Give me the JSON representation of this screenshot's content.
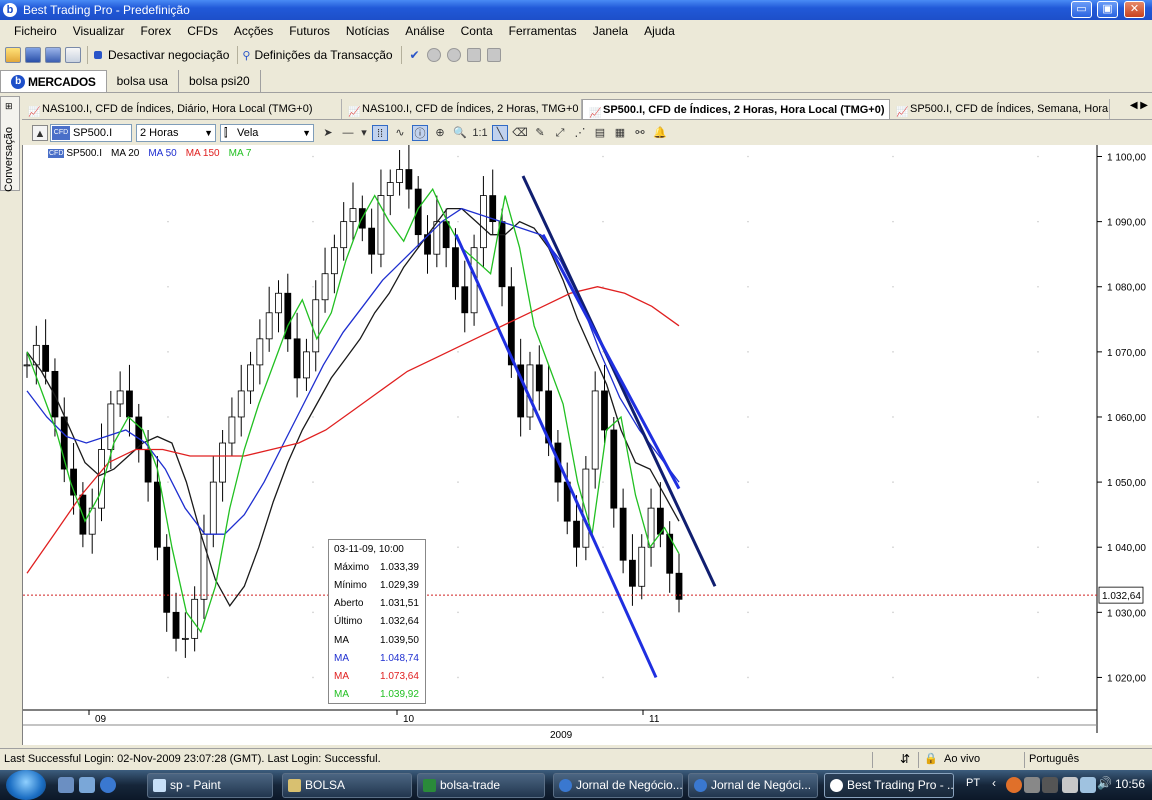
{
  "window": {
    "title": "Best Trading Pro - Predefinição",
    "logo_letter": "b",
    "buttons": {
      "minimize": "▭",
      "restore": "▣",
      "close": "✕"
    }
  },
  "menu": [
    "Ficheiro",
    "Visualizar",
    "Forex",
    "CFDs",
    "Acções",
    "Futuros",
    "Notícias",
    "Análise",
    "Conta",
    "Ferramentas",
    "Janela",
    "Ajuda"
  ],
  "toolbar": {
    "deactivate_label": "Desactivar negociação",
    "settings_label": "Definições da Transacção"
  },
  "workspace_tabs": [
    "MERCADOS",
    "bolsa usa",
    "bolsa psi20"
  ],
  "left_panel": {
    "label": "Conversação"
  },
  "chart_tabs": [
    "NAS100.I, CFD de Índices, Diário, Hora Local (TMG+0)",
    "NAS100.I, CFD de Índices, 2 Horas, TMG+0",
    "SP500.I, CFD de Índices, 2 Horas, Hora Local (TMG+0)",
    "SP500.I, CFD de Índices, Semana, Hora"
  ],
  "chart_tab_arrows": "◀ ▶",
  "chart_toolbar": {
    "symbol": "SP500.I",
    "symbol_badge": "CFD",
    "interval": "2 Horas",
    "chart_style": "Vela",
    "zoom_label": "1:1"
  },
  "legend": [
    {
      "label": "SP500.I",
      "color": "#000000"
    },
    {
      "label": "MA 20",
      "color": "#000000"
    },
    {
      "label": "MA 50",
      "color": "#1f2fd0"
    },
    {
      "label": "MA 150",
      "color": "#e02020"
    },
    {
      "label": "MA 7",
      "color": "#22c022"
    }
  ],
  "chart_data": {
    "type": "candlestick",
    "x_labels": [
      "09",
      "10",
      "11"
    ],
    "x_year": "2009",
    "y_ticks": [
      "1 020,00",
      "1 030,00",
      "1 040,00",
      "1 050,00",
      "1 060,00",
      "1 070,00",
      "1 080,00",
      "1 090,00",
      "1 100,00"
    ],
    "ylim": [
      1015,
      1101
    ],
    "current_price": 1032.64,
    "current_price_label": "1.032,64",
    "series": [
      {
        "name": "SP500.I",
        "color": "#000000",
        "values": [
          1068,
          1071,
          1067,
          1060,
          1052,
          1048,
          1042,
          1046,
          1055,
          1062,
          1064,
          1060,
          1055,
          1050,
          1040,
          1030,
          1026,
          1026,
          1032,
          1042,
          1050,
          1056,
          1060,
          1064,
          1068,
          1072,
          1076,
          1079,
          1072,
          1066,
          1070,
          1078,
          1082,
          1086,
          1090,
          1092,
          1089,
          1085,
          1094,
          1096,
          1098,
          1095,
          1088,
          1085,
          1090,
          1086,
          1080,
          1076,
          1086,
          1094,
          1090,
          1080,
          1068,
          1060,
          1068,
          1064,
          1056,
          1050,
          1044,
          1040,
          1052,
          1064,
          1058,
          1046,
          1038,
          1034,
          1040,
          1046,
          1042,
          1036,
          1032
        ]
      },
      {
        "name": "MA 20",
        "color": "#1a1a1a",
        "values": [
          1070,
          1067,
          1063,
          1058,
          1053,
          1051,
          1052,
          1054,
          1056,
          1057,
          1056,
          1050,
          1042,
          1035,
          1031,
          1034,
          1040,
          1047,
          1053,
          1058,
          1062,
          1066,
          1069,
          1072,
          1076,
          1079,
          1083,
          1086,
          1089,
          1092,
          1092,
          1090,
          1088,
          1088,
          1090,
          1089,
          1086,
          1081,
          1075,
          1070,
          1065,
          1058,
          1053,
          1052,
          1048,
          1044
        ]
      },
      {
        "name": "MA 50",
        "color": "#1f2fd0",
        "values": [
          1064,
          1060,
          1057,
          1056,
          1057,
          1058,
          1056,
          1052,
          1046,
          1042,
          1042,
          1045,
          1050,
          1056,
          1062,
          1068,
          1073,
          1077,
          1081,
          1084,
          1087,
          1090,
          1092,
          1091,
          1090,
          1089,
          1088,
          1084,
          1078,
          1070,
          1063,
          1058,
          1054,
          1050
        ]
      },
      {
        "name": "MA 150",
        "color": "#e02020",
        "values": [
          1036,
          1042,
          1048,
          1053,
          1055,
          1055,
          1054,
          1054,
          1054,
          1055,
          1056,
          1058,
          1061,
          1064,
          1067,
          1069,
          1071,
          1073,
          1075,
          1077,
          1079,
          1080,
          1079,
          1077,
          1074
        ]
      },
      {
        "name": "MA 7",
        "color": "#22c022",
        "values": [
          1070,
          1064,
          1058,
          1050,
          1044,
          1048,
          1056,
          1060,
          1058,
          1052,
          1040,
          1030,
          1027,
          1034,
          1046,
          1055,
          1062,
          1068,
          1074,
          1078,
          1072,
          1076,
          1084,
          1090,
          1094,
          1090,
          1087,
          1092,
          1095,
          1090,
          1086,
          1084,
          1082,
          1094,
          1086,
          1074,
          1068,
          1062,
          1050,
          1042,
          1058,
          1060,
          1048,
          1040,
          1043,
          1039
        ]
      }
    ],
    "trend_lines": [
      {
        "color": "#1f2fe0",
        "from": [
          1088,
          "2009-10-29"
        ],
        "to": [
          1020,
          "2009-11-04"
        ]
      },
      {
        "color": "#101e70",
        "from": [
          1097,
          "2009-10-28"
        ],
        "to": [
          1034,
          "2009-11-04"
        ]
      },
      {
        "color": "#1f2fe0",
        "from": [
          1088,
          "2009-10-30"
        ],
        "to": [
          1049,
          "2009-11-04"
        ]
      }
    ]
  },
  "info_box": {
    "date": "03-11-09, 10:00",
    "rows": [
      {
        "k": "Máximo",
        "v": "1.033,39",
        "color": "#000000"
      },
      {
        "k": "Mínimo",
        "v": "1.029,39",
        "color": "#000000"
      },
      {
        "k": "Aberto",
        "v": "1.031,51",
        "color": "#000000"
      },
      {
        "k": "Último",
        "v": "1.032,64",
        "color": "#000000"
      },
      {
        "k": "MA",
        "v": "1.039,50",
        "color": "#000000"
      },
      {
        "k": "MA",
        "v": "1.048,74",
        "color": "#1f2fd0"
      },
      {
        "k": "MA",
        "v": "1.073,64",
        "color": "#e02020"
      },
      {
        "k": "MA",
        "v": "1.039,92",
        "color": "#22c022"
      }
    ]
  },
  "status": {
    "login_text": "Last Successful Login: 02-Nov-2009 23:07:28 (GMT). Last Login: Successful.",
    "live_label": "Ao vivo",
    "language": "Português"
  },
  "taskbar": {
    "buttons": [
      "sp - Paint",
      "BOLSA",
      "bolsa-trade",
      "Jornal de Negócio...",
      "Jornal de Negóci...",
      "Best Trading Pro - ..."
    ],
    "lang": "PT",
    "time": "10:56"
  }
}
